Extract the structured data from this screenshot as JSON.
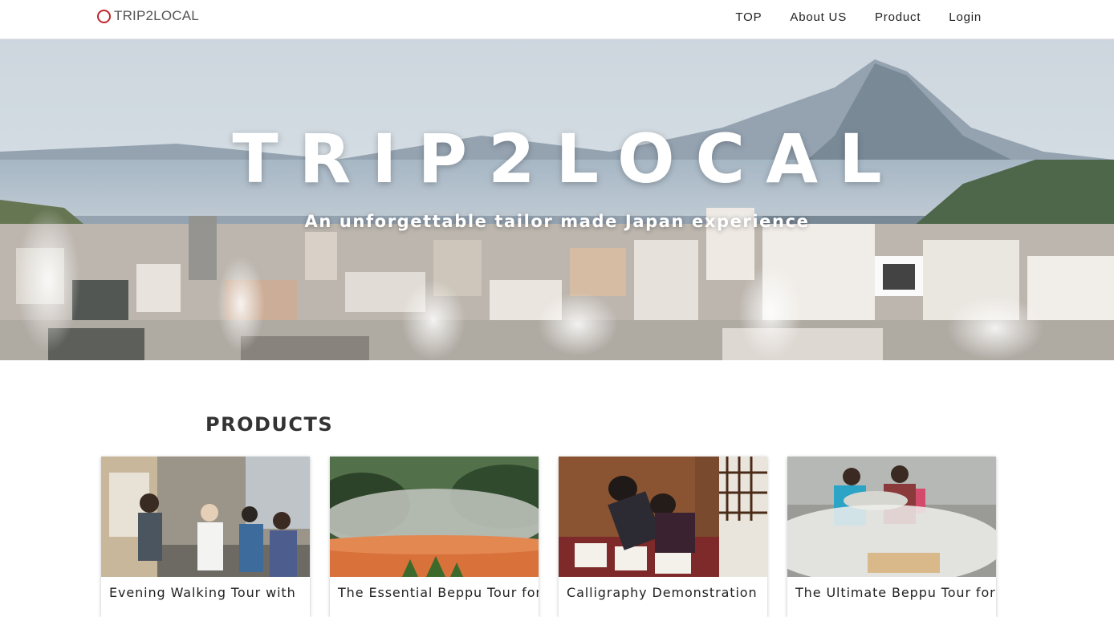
{
  "header": {
    "logo_text": "TRIP2LOCAL",
    "nav": [
      "TOP",
      "About US",
      "Product",
      "Login"
    ]
  },
  "hero": {
    "title": "TRIP2LOCAL",
    "subtitle": "An unforgettable tailor made Japan experience"
  },
  "products": {
    "heading": "PRODUCTS",
    "items": [
      {
        "title": "Evening Walking Tour with"
      },
      {
        "title": "The Essential Beppu Tour for"
      },
      {
        "title": "Calligraphy Demonstration"
      },
      {
        "title": "The Ultimate Beppu Tour for"
      }
    ]
  },
  "colors": {
    "brand_red": "#c0262d",
    "text": "#222222"
  }
}
